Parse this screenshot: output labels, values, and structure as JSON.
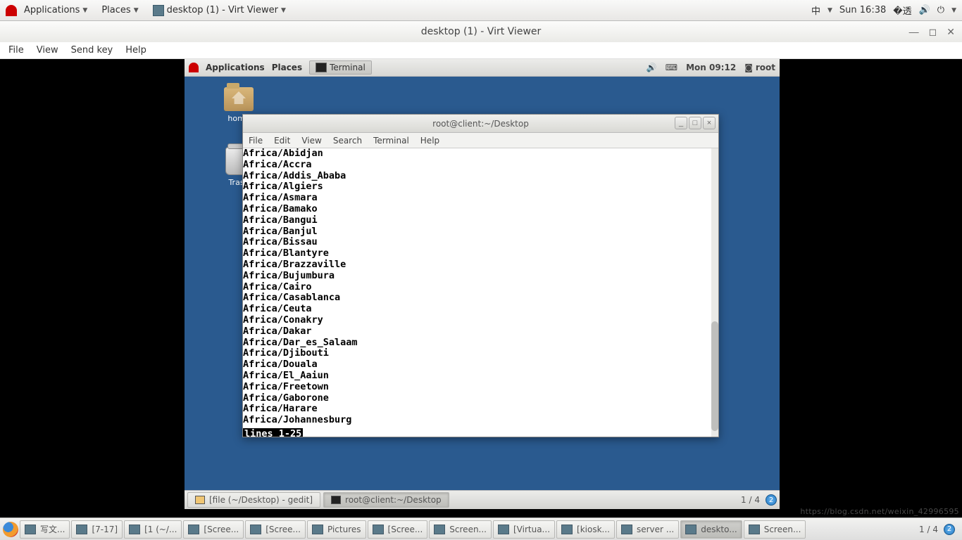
{
  "outer_panel": {
    "applications": "Applications",
    "places": "Places",
    "app_title": "desktop (1) - Virt Viewer",
    "input_method": "中",
    "clock": "Sun 16:38"
  },
  "virt_viewer": {
    "title": "desktop (1) - Virt Viewer",
    "menu": {
      "file": "File",
      "view": "View",
      "sendkey": "Send key",
      "help": "Help"
    }
  },
  "guest_panel": {
    "applications": "Applications",
    "places": "Places",
    "task": "Terminal",
    "clock": "Mon 09:12",
    "user": "root"
  },
  "desktop": {
    "home": "home",
    "trash": "Trash"
  },
  "terminal": {
    "title": "root@client:~/Desktop",
    "menu": {
      "file": "File",
      "edit": "Edit",
      "view": "View",
      "search": "Search",
      "terminal": "Terminal",
      "help": "Help"
    },
    "lines": [
      "Africa/Abidjan",
      "Africa/Accra",
      "Africa/Addis_Ababa",
      "Africa/Algiers",
      "Africa/Asmara",
      "Africa/Bamako",
      "Africa/Bangui",
      "Africa/Banjul",
      "Africa/Bissau",
      "Africa/Blantyre",
      "Africa/Brazzaville",
      "Africa/Bujumbura",
      "Africa/Cairo",
      "Africa/Casablanca",
      "Africa/Ceuta",
      "Africa/Conakry",
      "Africa/Dakar",
      "Africa/Dar_es_Salaam",
      "Africa/Djibouti",
      "Africa/Douala",
      "Africa/El_Aaiun",
      "Africa/Freetown",
      "Africa/Gaborone",
      "Africa/Harare",
      "Africa/Johannesburg"
    ],
    "status": "lines 1-25"
  },
  "guest_taskbar": {
    "item1": "[file (~/Desktop) - gedit]",
    "item2": "root@client:~/Desktop",
    "workspace": "1 / 4"
  },
  "host_taskbar": {
    "items": [
      "写文...",
      "[7-17]",
      "[1 (~/...",
      "[Scree...",
      "[Scree...",
      "Pictures",
      "[Scree...",
      "Screen...",
      "[Virtua...",
      "[kiosk...",
      "server ...",
      "deskto...",
      "Screen..."
    ],
    "active_index": 11,
    "workspace": "1 / 4"
  },
  "watermark": "https://blog.csdn.net/weixin_42996595"
}
